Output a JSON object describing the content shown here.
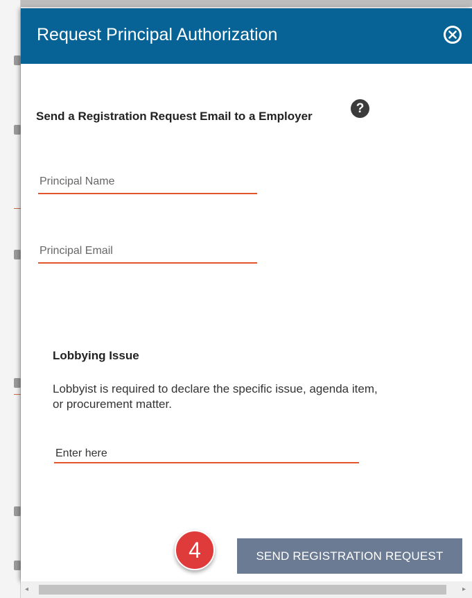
{
  "modal": {
    "title": "Request Principal Authorization",
    "close_icon": "close-circle-icon",
    "section_heading": "Send a Registration Request Email to a Employer",
    "help_icon": "question-circle-icon",
    "help_glyph": "?"
  },
  "fields": {
    "principal_name": {
      "placeholder": "Principal Name",
      "value": ""
    },
    "principal_email": {
      "placeholder": "Principal Email",
      "value": ""
    }
  },
  "lobbying": {
    "title": "Lobbying Issue",
    "description": "Lobbyist is required to declare the specific issue, agenda item, or procurement matter.",
    "issue_placeholder": "Enter here",
    "issue_value": ""
  },
  "step_badge": "4",
  "send_button_label": "SEND REGISTRATION REQUEST",
  "colors": {
    "header": "#076396",
    "field_underline": "#e2542b",
    "send_button": "#6b7b93",
    "step_badge": "#e03b3b"
  },
  "scrollbar": {
    "left_arrow_icon": "arrow-left-icon",
    "right_arrow_icon": "arrow-right-icon"
  }
}
